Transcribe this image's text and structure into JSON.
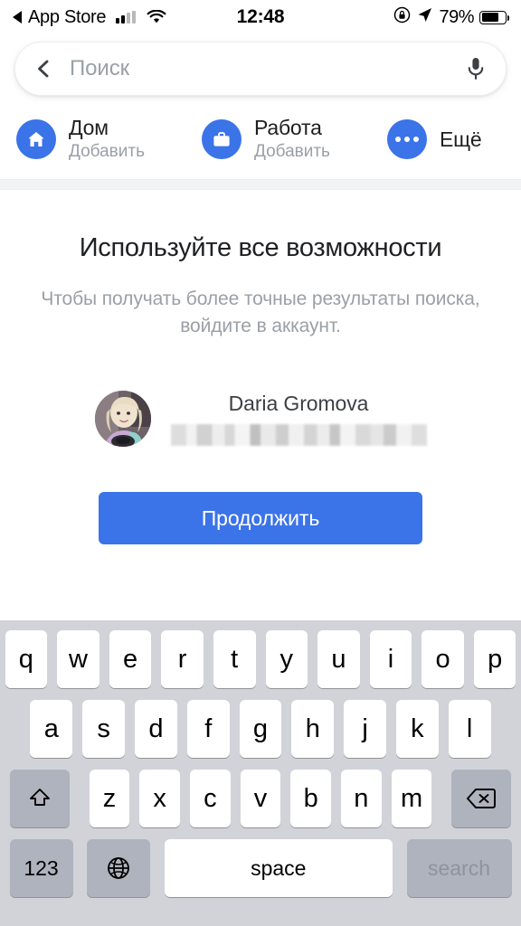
{
  "status_bar": {
    "back_app": "App Store",
    "back_icon": "triangle-left-icon",
    "signal_icon": "cellular-signal-icon",
    "wifi_icon": "wifi-icon",
    "time": "12:48",
    "rotation_lock_icon": "rotation-lock-icon",
    "location_icon": "location-arrow-icon",
    "battery_percent": "79%",
    "battery_icon": "battery-icon"
  },
  "search": {
    "back_icon": "chevron-left-icon",
    "placeholder": "Поиск",
    "value": "",
    "mic_icon": "microphone-icon"
  },
  "shortcuts": [
    {
      "icon": "home-icon",
      "title": "Дом",
      "subtitle": "Добавить"
    },
    {
      "icon": "briefcase-icon",
      "title": "Работа",
      "subtitle": "Добавить"
    },
    {
      "icon": "more-dots-icon",
      "title": "Ещё",
      "subtitle": ""
    }
  ],
  "promo": {
    "title": "Используйте все возможности",
    "subtitle": "Чтобы получать более точные результаты поиска, войдите в аккаунт.",
    "account": {
      "avatar_icon": "user-avatar-photo",
      "name": "Daria Gromova",
      "email_redacted": true
    },
    "cta_label": "Продолжить"
  },
  "keyboard": {
    "row1": [
      "q",
      "w",
      "e",
      "r",
      "t",
      "y",
      "u",
      "i",
      "o",
      "p"
    ],
    "row2": [
      "a",
      "s",
      "d",
      "f",
      "g",
      "h",
      "j",
      "k",
      "l"
    ],
    "row3": [
      "z",
      "x",
      "c",
      "v",
      "b",
      "n",
      "m"
    ],
    "shift_icon": "shift-arrow-icon",
    "delete_icon": "backspace-delete-icon",
    "numbers_label": "123",
    "globe_icon": "globe-language-icon",
    "space_label": "space",
    "search_label": "search"
  },
  "colors": {
    "accent_blue": "#3b73e8",
    "keyboard_bg": "#d1d3d9",
    "key_white": "#ffffff",
    "key_grey": "#aeb3bd",
    "text_muted": "#9aa0a6"
  }
}
